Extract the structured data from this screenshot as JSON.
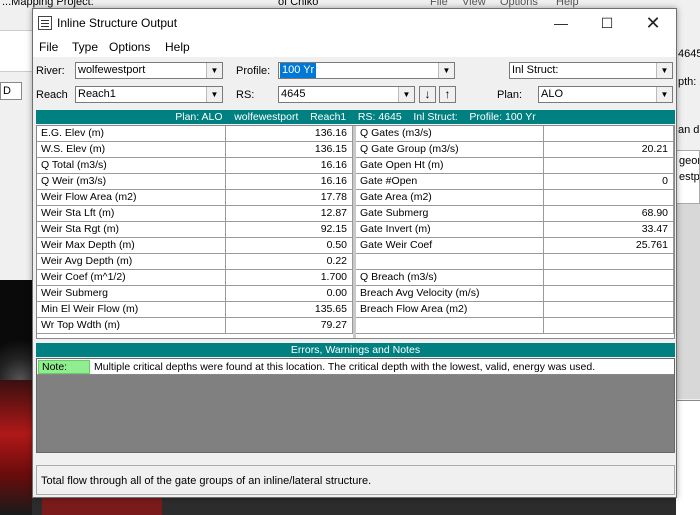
{
  "background": {
    "left_text_d": "D",
    "top_fragment_left": "...Mapping Project:",
    "top_fragment_mid": "of Chiko",
    "top_menu": [
      "File",
      "View",
      "Options",
      "Help"
    ],
    "right_fragments": [
      "4645",
      "pth: 2",
      "an d",
      "geon",
      "estpo"
    ]
  },
  "window": {
    "title": "Inline Structure Output",
    "controls": {
      "minimize": "—",
      "maximize": "☐",
      "close": "✕"
    }
  },
  "menu": [
    "File",
    "Type",
    "Options",
    "Help"
  ],
  "selectors": {
    "river_label": "River:",
    "river_value": "wolfewestport",
    "reach_label": "Reach",
    "reach_value": "Reach1",
    "profile_label": "Profile:",
    "profile_value": "100 Yr",
    "rs_label": "RS:",
    "rs_value": "4645",
    "inl_struct_value": "Inl Struct:",
    "plan_label": "Plan:",
    "plan_value": "ALO"
  },
  "header_bar": "Plan: ALO    wolfewestport    Reach1    RS: 4645    Inl Struct:    Profile: 100 Yr",
  "left_table": [
    {
      "name": "E.G. Elev (m)",
      "value": "136.16"
    },
    {
      "name": "W.S. Elev (m)",
      "value": "136.15"
    },
    {
      "name": "Q Total (m3/s)",
      "value": "16.16"
    },
    {
      "name": "Q Weir (m3/s)",
      "value": "16.16"
    },
    {
      "name": "Weir Flow Area (m2)",
      "value": "17.78"
    },
    {
      "name": "Weir Sta Lft (m)",
      "value": "12.87"
    },
    {
      "name": "Weir Sta Rgt (m)",
      "value": "92.15"
    },
    {
      "name": "Weir Max Depth (m)",
      "value": "0.50"
    },
    {
      "name": "Weir Avg Depth (m)",
      "value": "0.22"
    },
    {
      "name": "Weir Coef (m^1/2)",
      "value": "1.700"
    },
    {
      "name": "Weir Submerg",
      "value": "0.00"
    },
    {
      "name": "Min El Weir Flow (m)",
      "value": "135.65"
    },
    {
      "name": "Wr Top Wdth (m)",
      "value": "79.27"
    }
  ],
  "right_table": [
    {
      "name": "Q Gates (m3/s)",
      "value": ""
    },
    {
      "name": "Q Gate Group (m3/s)",
      "value": "20.21"
    },
    {
      "name": "Gate Open Ht (m)",
      "value": ""
    },
    {
      "name": "Gate #Open",
      "value": "0"
    },
    {
      "name": "Gate Area (m2)",
      "value": ""
    },
    {
      "name": "Gate Submerg",
      "value": "68.90"
    },
    {
      "name": "Gate Invert (m)",
      "value": "33.47"
    },
    {
      "name": "Gate Weir Coef",
      "value": "25.761"
    },
    {
      "name": "",
      "value": ""
    },
    {
      "name": "Q Breach (m3/s)",
      "value": ""
    },
    {
      "name": "Breach Avg Velocity (m/s)",
      "value": ""
    },
    {
      "name": "Breach Flow Area (m2)",
      "value": ""
    },
    {
      "name": "",
      "value": ""
    }
  ],
  "notes_header": "Errors, Warnings and Notes",
  "notes": [
    {
      "tag": "Note:",
      "text": "Multiple critical depths were found at this location.  The critical depth with the lowest, valid, energy was used."
    }
  ],
  "status": "Total flow through all of the gate groups of an inline/lateral structure."
}
